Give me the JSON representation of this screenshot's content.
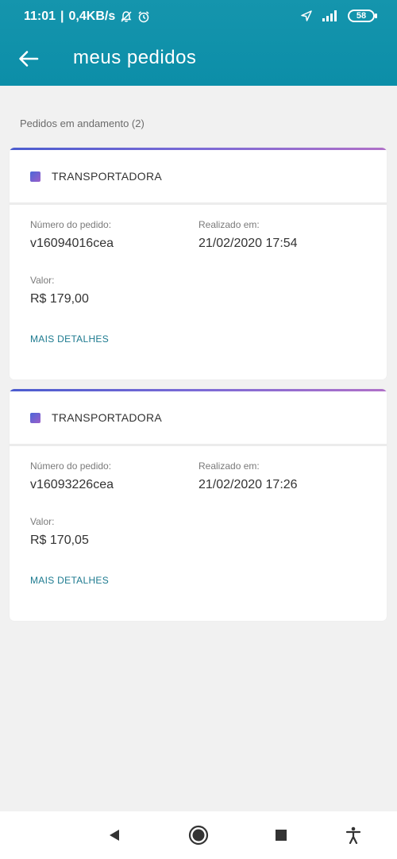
{
  "status_bar": {
    "time": "11:01",
    "speed": "0,4KB/s",
    "battery": "58",
    "icons": [
      "bell-off-icon",
      "alarm-icon",
      "location-icon",
      "signal-icon",
      "battery-icon"
    ]
  },
  "app_bar": {
    "title": "meus pedidos",
    "back_icon": "arrow-left-icon",
    "background": "#0c8ea8"
  },
  "section": {
    "title": "Pedidos em andamento (2)"
  },
  "orders": [
    {
      "carrier": "TRANSPORTADORA",
      "order_label": "Número do pedido:",
      "order_number": "v16094016cea",
      "date_label": "Realizado em:",
      "date": "21/02/2020 17:54",
      "value_label": "Valor:",
      "value": "R$  179,00",
      "details": "MAIS DETALHES"
    },
    {
      "carrier": "TRANSPORTADORA",
      "order_label": "Número do pedido:",
      "order_number": "v16093226cea",
      "date_label": "Realizado em:",
      "date": "21/02/2020 17:26",
      "value_label": "Valor:",
      "value": "R$  170,05",
      "details": "MAIS DETALHES"
    }
  ],
  "nav_bar": {
    "icons": [
      "back-triangle-icon",
      "home-circle-icon",
      "recents-square-icon",
      "accessibility-icon"
    ]
  }
}
